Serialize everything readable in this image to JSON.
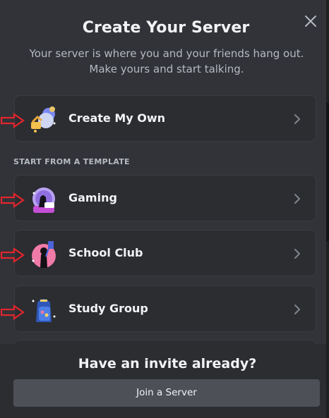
{
  "modal": {
    "title": "Create Your Server",
    "subtitle": "Your server is where you and your friends hang out. Make yours and start talking.",
    "close_icon": "close-icon"
  },
  "options": {
    "create_my_own": {
      "label": "Create My Own",
      "icon": "create-server-icon"
    },
    "section_label": "START FROM A TEMPLATE",
    "templates": [
      {
        "label": "Gaming",
        "icon": "gaming-icon"
      },
      {
        "label": "School Club",
        "icon": "school-club-icon"
      },
      {
        "label": "Study Group",
        "icon": "study-group-icon"
      }
    ]
  },
  "footer": {
    "heading": "Have an invite already?",
    "join_label": "Join a Server"
  },
  "colors": {
    "background": "#313338",
    "card": "#2b2d31",
    "button": "#4e5058",
    "annotation_arrow": "#e0262c"
  }
}
